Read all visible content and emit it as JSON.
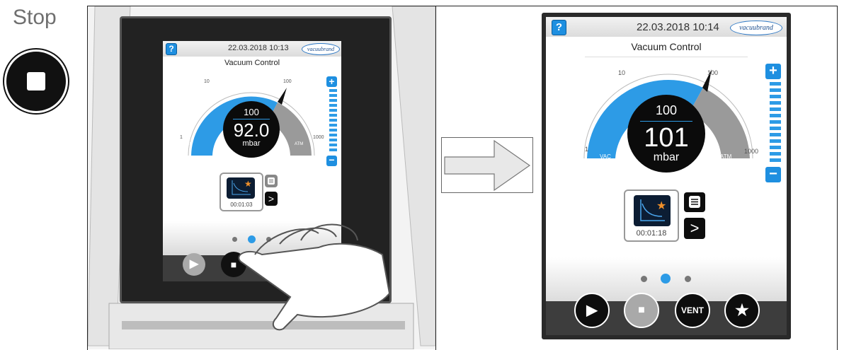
{
  "step": {
    "label": "Stop",
    "icon": "stop-icon"
  },
  "colors": {
    "accent": "#1e8fe0",
    "dial_blue": "#2d9be6",
    "dial_gray": "#9a9a9a",
    "panel_dark": "#0d0d0d"
  },
  "left_screen": {
    "help": "?",
    "datetime": "22.03.2018  10:13",
    "logo": "vacuubrand",
    "title": "Vacuum Control",
    "setpoint": "100",
    "value": "92.0",
    "unit": "mbar",
    "scale": {
      "s1": "1",
      "s10": "10",
      "s100": "100",
      "s1000": "1000",
      "vac": "VAC",
      "atm": "ATM"
    },
    "timer": "00:01:03"
  },
  "right_screen": {
    "help": "?",
    "datetime": "22.03.2018  10:14",
    "logo": "vacuubrand",
    "title": "Vacuum Control",
    "setpoint": "100",
    "value": "101",
    "unit": "mbar",
    "scale": {
      "s1": "1",
      "s10": "10",
      "s100": "100",
      "s1000": "1000",
      "vac": "VAC",
      "atm": "ATM"
    },
    "timer": "00:01:18",
    "vent_label": "VENT"
  }
}
